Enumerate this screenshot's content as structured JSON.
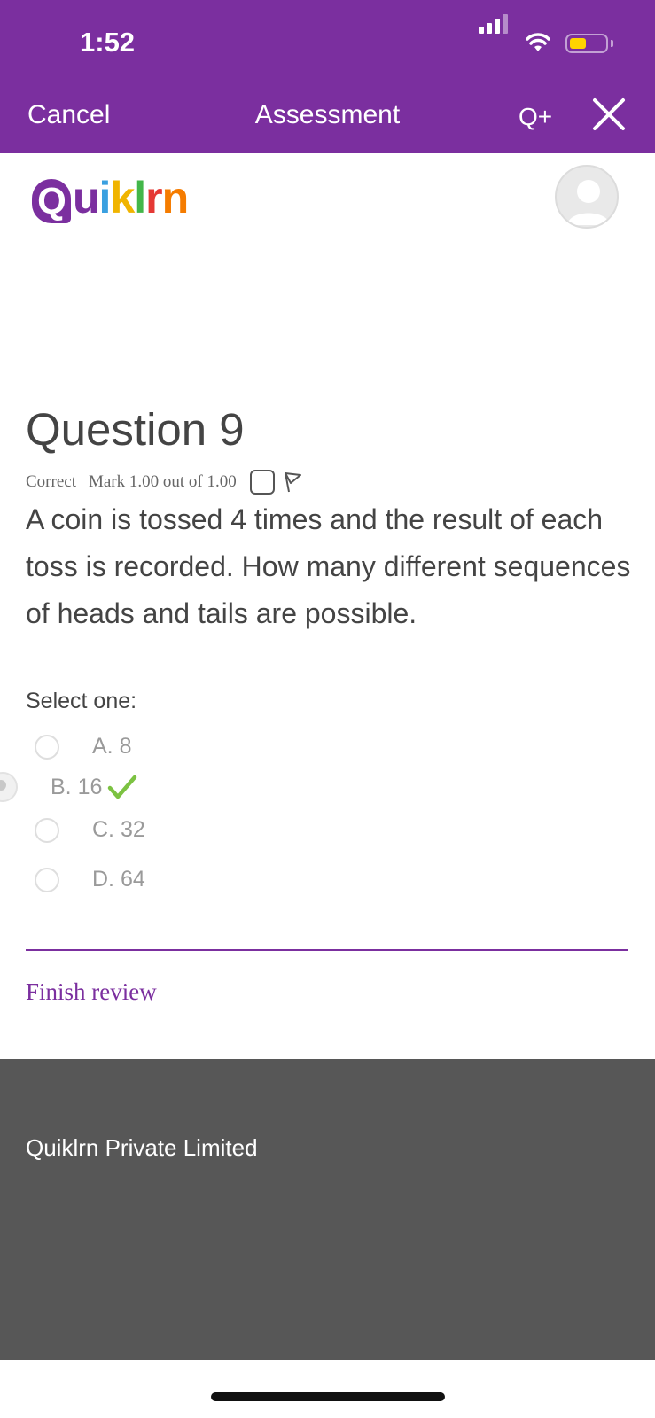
{
  "status_bar": {
    "time": "1:52"
  },
  "nav": {
    "cancel_label": "Cancel",
    "title": "Assessment",
    "qplus_label": "Q+"
  },
  "logo": {
    "letters": [
      "Q",
      "u",
      "i",
      "k",
      "l",
      "r",
      "n"
    ],
    "colors": [
      "#7b2f9f",
      "#7b2f9f",
      "#3aa0e0",
      "#f0b400",
      "#43b649",
      "#e53935",
      "#f57c00"
    ]
  },
  "question": {
    "title": "Question 9",
    "status": "Correct",
    "mark": "Mark 1.00 out of 1.00",
    "text": "A coin is tossed 4 times and the result of each toss is recorded. How many different sequences of heads and tails are possible.",
    "prompt": "Select one:",
    "options": [
      {
        "label": "A. 8",
        "selected": false
      },
      {
        "label": "B. 16",
        "selected": true,
        "correct": true
      },
      {
        "label": "C. 32",
        "selected": false
      },
      {
        "label": "D. 64",
        "selected": false
      }
    ]
  },
  "finish_review_label": "Finish review",
  "footer": {
    "company": "Quiklrn Private Limited"
  },
  "colors": {
    "brand_purple": "#7b2f9f",
    "footer_gray": "#575757",
    "check_green": "#7cc242",
    "battery_yellow": "#ffd400"
  }
}
